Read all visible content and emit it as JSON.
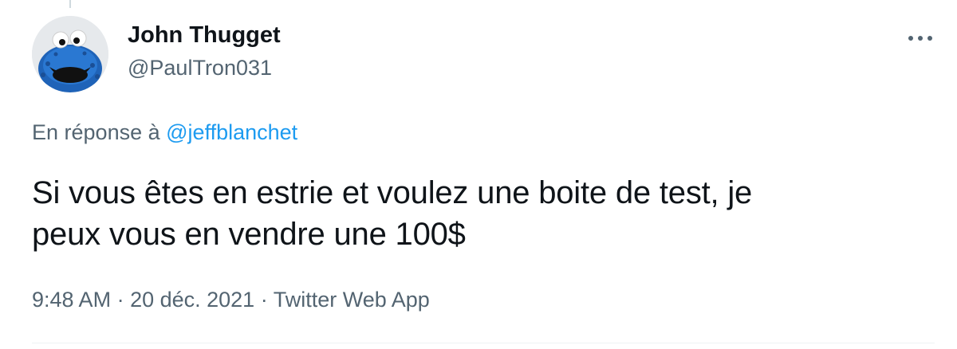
{
  "tweet": {
    "author_name": "John Thugget",
    "author_handle": "@PaulTron031",
    "reply_prefix": "En réponse à",
    "reply_to": "@jeffblanchet",
    "text_line1": "Si vous êtes en estrie et voulez une boite de test, je",
    "text_line2": "peux vous en vendre une 100$",
    "time": "9:48 AM",
    "separator": " · ",
    "date": "20 déc. 2021",
    "source": "Twitter Web App"
  },
  "icons": {
    "avatar": "cookie-monster-avatar",
    "more": "more-horizontal-icon"
  },
  "colors": {
    "link": "#1d9bf0",
    "secondary_text": "#536471",
    "primary_text": "#0f1419"
  }
}
